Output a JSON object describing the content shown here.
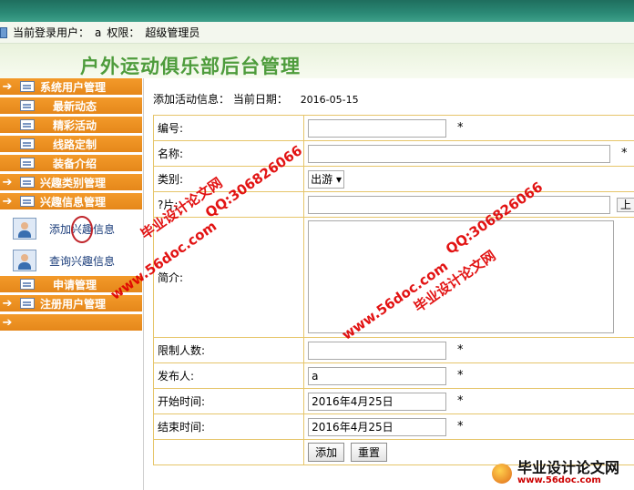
{
  "header": {
    "current_user_label": "当前登录用户：",
    "current_user": "a",
    "role_label": "权限：",
    "role": "超级管理员",
    "system_title": "户外运动俱乐部后台管理"
  },
  "sidebar": {
    "items": [
      {
        "label": "系统用户管理",
        "arrow": "➔"
      },
      {
        "label": "最新动态"
      },
      {
        "label": "精彩活动"
      },
      {
        "label": "线路定制"
      },
      {
        "label": "装备介绍"
      },
      {
        "label": "兴趣类别管理",
        "arrow": "➔"
      },
      {
        "label": "兴趣信息管理",
        "arrow": "➔"
      },
      {
        "label": "申请管理"
      },
      {
        "label": "注册用户管理",
        "arrow": "➔"
      },
      {
        "label": "",
        "arrow": "➔"
      }
    ],
    "sub_items": [
      {
        "label": "添加兴趣信息"
      },
      {
        "label": "查询兴趣信息"
      }
    ]
  },
  "main": {
    "page_label": "添加活动信息：",
    "date_label": "当前日期：",
    "date": "2016-05-15",
    "form": {
      "fields": [
        {
          "label": "编号:",
          "value": "",
          "required": "*"
        },
        {
          "label": "名称:",
          "value": "",
          "required": "*"
        },
        {
          "label": "类别:",
          "select_value": "出游 ▾"
        },
        {
          "label": "?片:",
          "value": "",
          "side_button": "上"
        },
        {
          "label": "简介:"
        },
        {
          "label": "限制人数:",
          "value": "",
          "required": "*"
        },
        {
          "label": "发布人:",
          "value": "a",
          "required": "*"
        },
        {
          "label": "开始时间:",
          "value": "2016年4月25日",
          "required": "*"
        },
        {
          "label": "结束时间:",
          "value": "2016年4月25日",
          "required": "*"
        }
      ],
      "add_button": "添加",
      "reset_button": "重置"
    }
  },
  "watermarks": {
    "site_cn": "毕业设计论文网",
    "url": "www.56doc.com",
    "qq": "QQ:306826066",
    "logo_text": "毕业设计论文网",
    "logo_url": "www.56doc.com"
  },
  "colors": {
    "menu_orange": "#e8891c",
    "title_green": "#4e9c3c",
    "top_teal": "#2b8a76",
    "table_border": "#e6c56a",
    "watermark_red": "#e00000"
  }
}
